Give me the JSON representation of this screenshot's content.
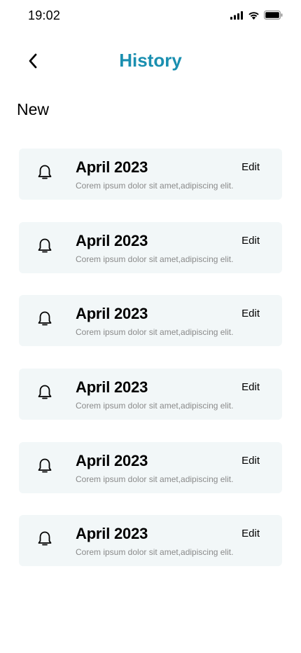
{
  "status_bar": {
    "time": "19:02",
    "icons": [
      "signal-icon",
      "wifi-icon",
      "battery-icon"
    ]
  },
  "header": {
    "title": "History",
    "back_icon": "chevron-left-icon",
    "title_color": "#1a8fb0"
  },
  "section": {
    "title": "New"
  },
  "items": [
    {
      "icon": "bell-icon",
      "title": "April 2023",
      "description": "Corem ipsum dolor sit amet,adipiscing elit.",
      "action": "Edit"
    },
    {
      "icon": "bell-icon",
      "title": "April 2023",
      "description": "Corem ipsum dolor sit amet,adipiscing elit.",
      "action": "Edit"
    },
    {
      "icon": "bell-icon",
      "title": "April 2023",
      "description": "Corem ipsum dolor sit amet,adipiscing elit.",
      "action": "Edit"
    },
    {
      "icon": "bell-icon",
      "title": "April 2023",
      "description": "Corem ipsum dolor sit amet,adipiscing elit.",
      "action": "Edit"
    },
    {
      "icon": "bell-icon",
      "title": "April 2023",
      "description": "Corem ipsum dolor sit amet,adipiscing elit.",
      "action": "Edit"
    },
    {
      "icon": "bell-icon",
      "title": "April 2023",
      "description": "Corem ipsum dolor sit amet,adipiscing elit.",
      "action": "Edit"
    }
  ],
  "colors": {
    "card_background": "#f2f7f8",
    "description_text": "#8a8a8a"
  }
}
